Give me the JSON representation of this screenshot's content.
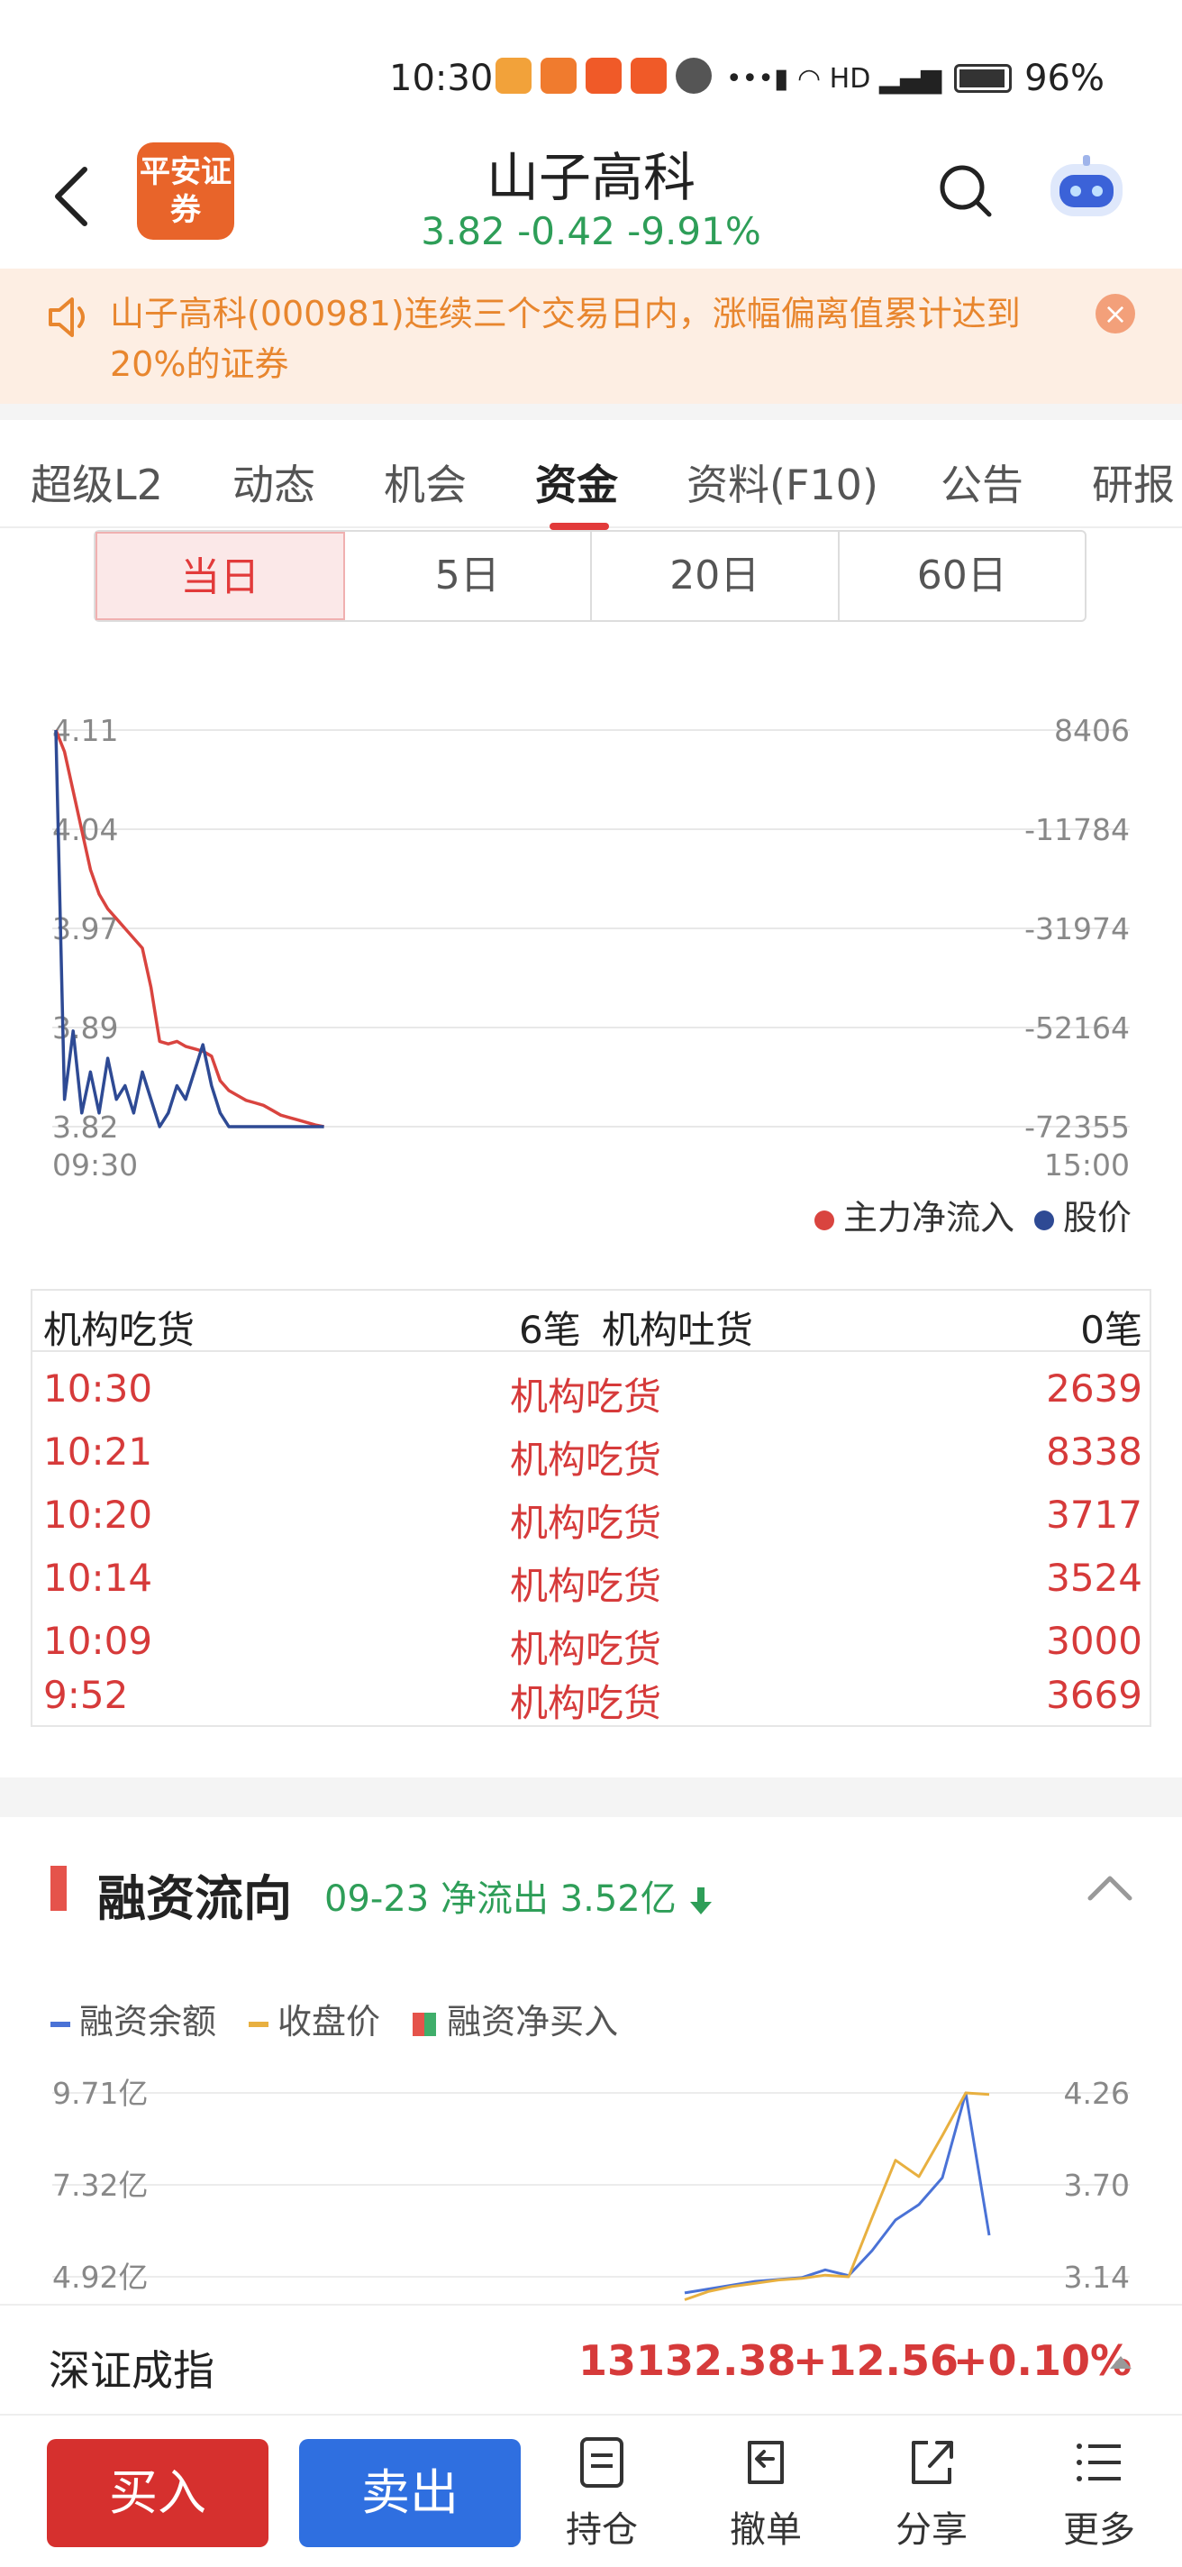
{
  "status_bar": {
    "time": "10:30",
    "battery": "96%"
  },
  "header": {
    "logo_text": "平安证券",
    "title": "山子高科",
    "price": "3.82",
    "change": "-0.42",
    "change_pct": "-9.91%"
  },
  "notice": {
    "text": "山子高科(000981)连续三个交易日内，涨幅偏离值累计达到20%的证券"
  },
  "tabs": [
    {
      "label": "超级L2"
    },
    {
      "label": "动态"
    },
    {
      "label": "机会"
    },
    {
      "label": "资金"
    },
    {
      "label": "资料(F10)"
    },
    {
      "label": "公告"
    },
    {
      "label": "研报"
    }
  ],
  "period_tabs": [
    {
      "label": "当日"
    },
    {
      "label": "5日"
    },
    {
      "label": "20日"
    },
    {
      "label": "60日"
    }
  ],
  "chart_data": [
    {
      "type": "line",
      "x_start_label": "09:30",
      "x_end_label": "15:00",
      "y_left_ticks": [
        "4.11",
        "4.04",
        "3.97",
        "3.89",
        "3.82"
      ],
      "y_right_ticks": [
        "8406",
        "-11784",
        "-31974",
        "-52164",
        "-72355"
      ],
      "ylim_left": [
        3.82,
        4.11
      ],
      "ylim_right": [
        -72355,
        8406
      ],
      "series": [
        {
          "name": "主力净流入",
          "color": "#d9443f",
          "axis": "right",
          "values": [
            8406,
            4000,
            -4000,
            -12000,
            -20000,
            -25000,
            -28000,
            -30000,
            -32000,
            -34000,
            -36000,
            -44000,
            -55000,
            -55500,
            -55000,
            -56000,
            -56500,
            -57000,
            -58000,
            -63000,
            -65000,
            -66000,
            -67000,
            -67500,
            -68000,
            -69000,
            -70000,
            -70500,
            -71000,
            -71500,
            -72000,
            -72355
          ]
        },
        {
          "name": "股价",
          "color": "#2e4a94",
          "axis": "left",
          "values": [
            4.11,
            3.84,
            3.89,
            3.83,
            3.86,
            3.83,
            3.87,
            3.84,
            3.85,
            3.83,
            3.86,
            3.84,
            3.82,
            3.83,
            3.85,
            3.84,
            3.86,
            3.88,
            3.85,
            3.83,
            3.82,
            3.82,
            3.82,
            3.82,
            3.82,
            3.82,
            3.82,
            3.82,
            3.82,
            3.82,
            3.82,
            3.82
          ]
        }
      ]
    },
    {
      "type": "line",
      "y_left_ticks": [
        "9.71亿",
        "7.32亿",
        "4.92亿"
      ],
      "y_right_ticks": [
        "4.26",
        "3.70",
        "3.14"
      ],
      "ylim_left": [
        4.92,
        9.71
      ],
      "ylim_right": [
        3.14,
        4.26
      ],
      "series": [
        {
          "name": "融资余额",
          "color": "#4a72d6",
          "axis": "left",
          "values": [
            4.5,
            4.6,
            4.7,
            4.8,
            4.85,
            4.9,
            5.1,
            4.95,
            5.6,
            6.4,
            6.8,
            7.5,
            9.71,
            6.0
          ]
        },
        {
          "name": "收盘价",
          "color": "#e8b040",
          "axis": "right",
          "values": [
            3.0,
            3.05,
            3.08,
            3.1,
            3.12,
            3.13,
            3.15,
            3.14,
            3.5,
            3.85,
            3.75,
            4.0,
            4.26,
            4.25
          ]
        }
      ]
    }
  ],
  "chart_legend": {
    "main_inflow": "主力净流入",
    "price": "股价"
  },
  "institution": {
    "buy_label": "机构吃货",
    "buy_count": "6笔",
    "sell_label": "机构吐货",
    "sell_count": "0笔",
    "rows": [
      {
        "time": "10:30",
        "type": "机构吃货",
        "volume": "2639"
      },
      {
        "time": "10:21",
        "type": "机构吃货",
        "volume": "8338"
      },
      {
        "time": "10:20",
        "type": "机构吃货",
        "volume": "3717"
      },
      {
        "time": "10:14",
        "type": "机构吃货",
        "volume": "3524"
      },
      {
        "time": "10:09",
        "type": "机构吃货",
        "volume": "3000"
      },
      {
        "time": "9:52",
        "type": "机构吃货",
        "volume": "3669"
      }
    ]
  },
  "margin": {
    "title": "融资流向",
    "subtitle": "09-23 净流出 3.52亿",
    "legend": [
      "融资余额",
      "收盘价",
      "融资净买入"
    ]
  },
  "index": {
    "name": "深证成指",
    "value": "13132.38",
    "change": "+12.56",
    "change_pct": "+0.10%"
  },
  "toolbar": {
    "buy": "买入",
    "sell": "卖出",
    "items": [
      {
        "label": "持仓",
        "icon": "document-icon"
      },
      {
        "label": "撤单",
        "icon": "undo-icon"
      },
      {
        "label": "分享",
        "icon": "share-icon"
      },
      {
        "label": "更多",
        "icon": "menu-icon"
      }
    ]
  }
}
